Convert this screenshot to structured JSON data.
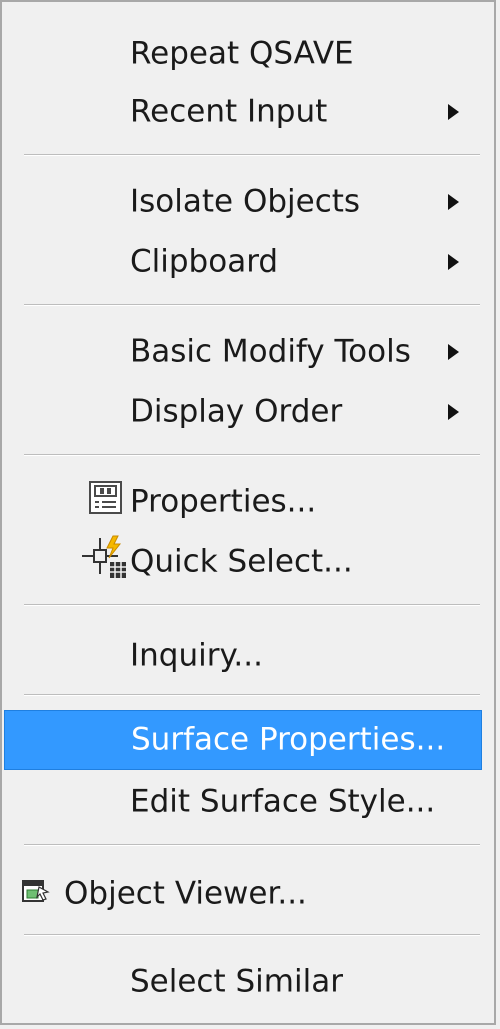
{
  "menu": {
    "items": [
      {
        "label": "Repeat QSAVE"
      },
      {
        "label": "Recent Input",
        "submenu": true
      },
      {
        "label": "Isolate Objects",
        "submenu": true
      },
      {
        "label": "Clipboard",
        "submenu": true
      },
      {
        "label": "Basic Modify Tools",
        "submenu": true
      },
      {
        "label": "Display Order",
        "submenu": true
      },
      {
        "label": "Properties...",
        "icon": "properties-icon"
      },
      {
        "label": "Quick Select...",
        "icon": "quick-select-icon"
      },
      {
        "label": "Inquiry..."
      },
      {
        "label": "Surface Properties...",
        "selected": true
      },
      {
        "label": "Edit Surface Style..."
      },
      {
        "label": "Object Viewer...",
        "icon": "object-viewer-icon"
      },
      {
        "label": "Select Similar"
      }
    ]
  },
  "colors": {
    "background": "#f0f0f0",
    "selected_bg": "#3399ff",
    "selected_text": "#ffffff",
    "text": "#1a1a1a",
    "icon_accent": "#f5b800"
  }
}
